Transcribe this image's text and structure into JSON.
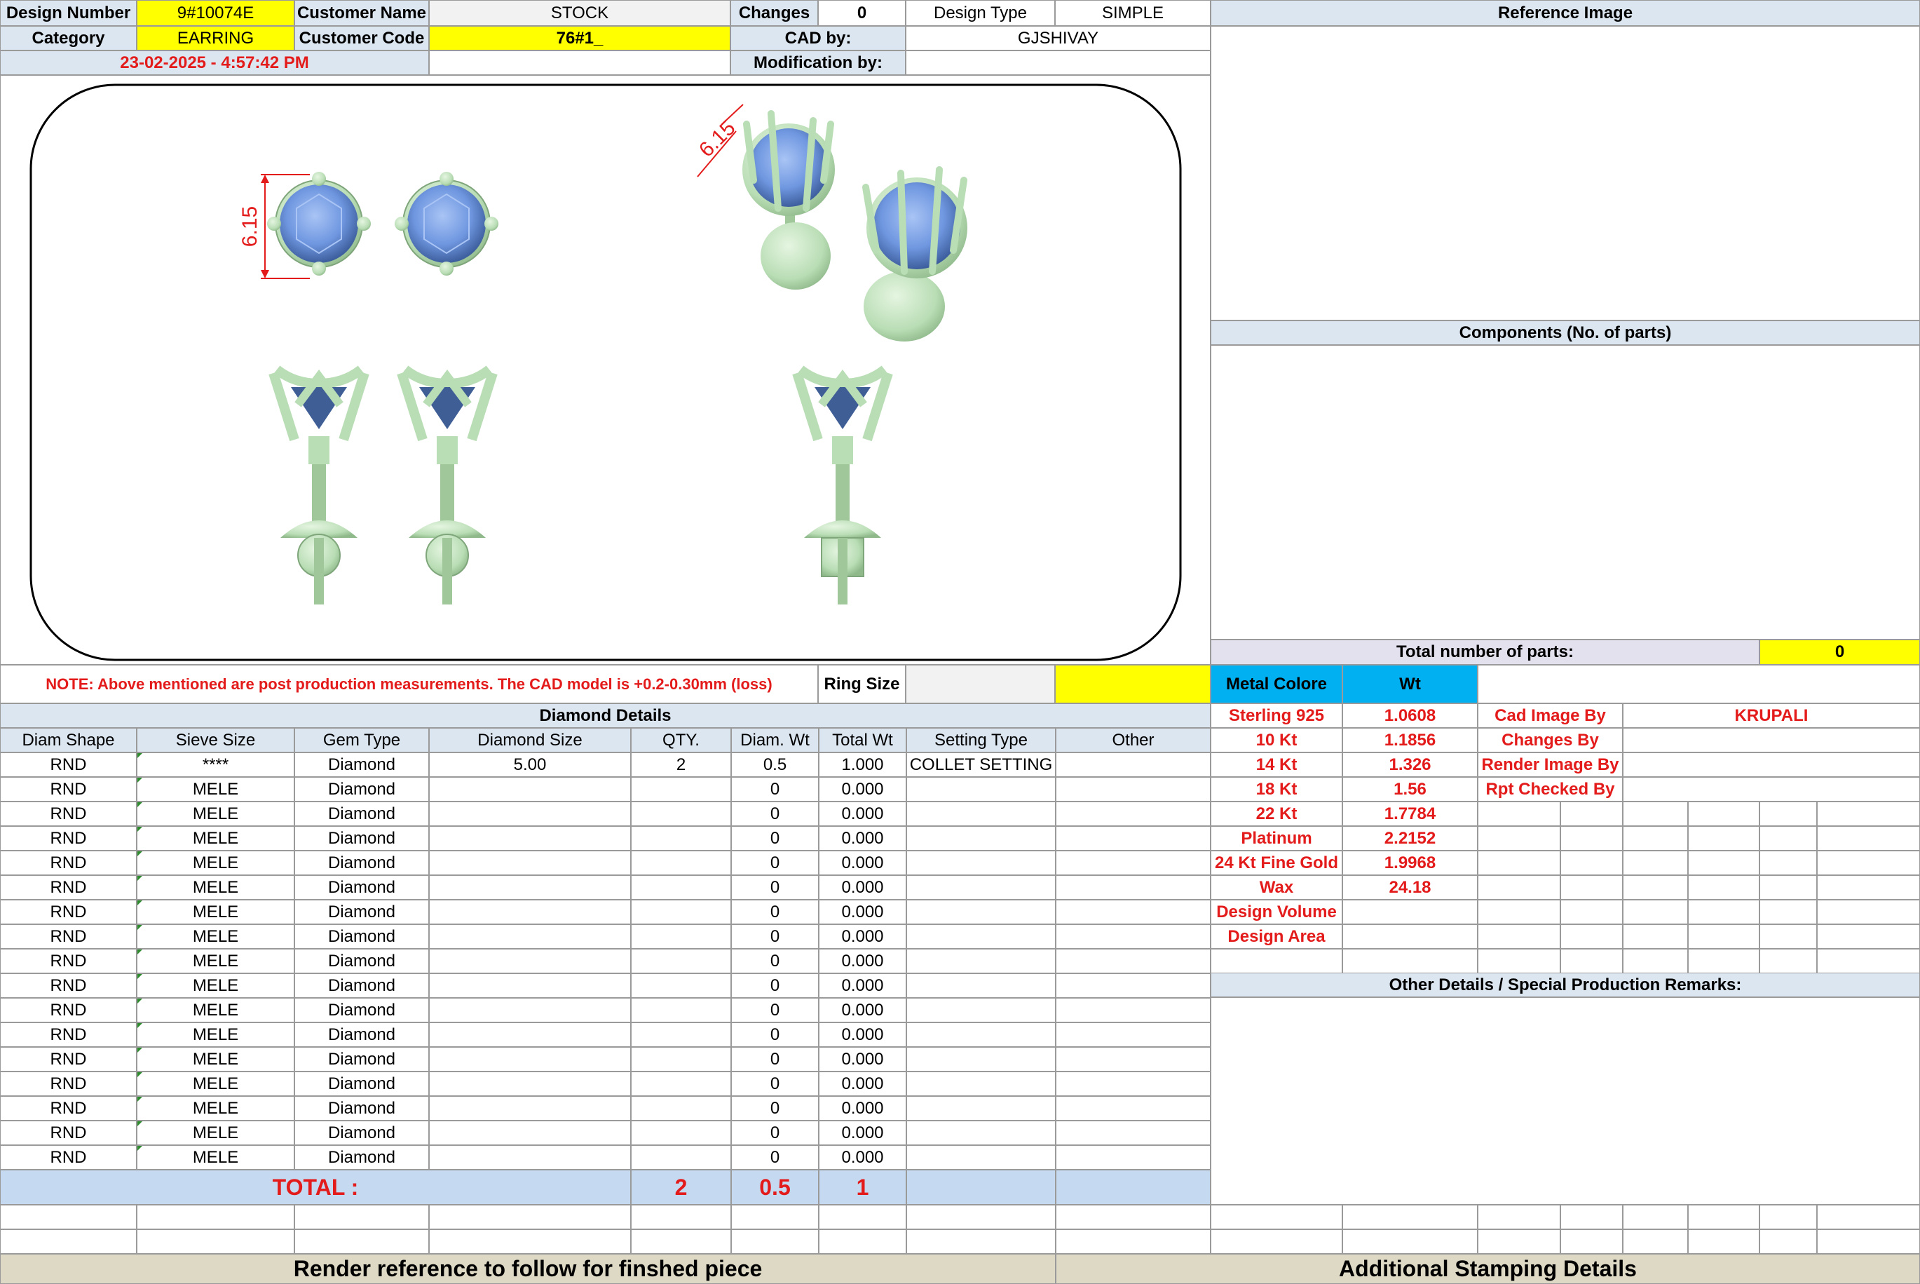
{
  "header": {
    "design_number_label": "Design Number",
    "design_number": "9#10074E",
    "customer_name_label": "Customer Name",
    "customer_name": "STOCK",
    "changes_label": "Changes",
    "changes": "0",
    "design_type_label": "Design Type",
    "design_type": "SIMPLE",
    "category_label": "Category",
    "category": "EARRING",
    "customer_code_label": "Customer Code",
    "customer_code": "76#1_",
    "cad_by_label": "CAD by:",
    "cad_by": "GJSHIVAY",
    "timestamp": "23-02-2025 - 4:57:42 PM",
    "modification_by_label": "Modification by:"
  },
  "render": {
    "dimension_label": "6.15"
  },
  "note": "NOTE: Above mentioned are post production measurements. The CAD model is +0.2-0.30mm (loss)",
  "ring_size_label": "Ring Size",
  "reference": {
    "title": "Reference Image",
    "components_title": "Components (No. of parts)",
    "total_parts_label": "Total number of parts:",
    "total_parts": "0"
  },
  "diamond": {
    "title": "Diamond Details",
    "columns": [
      "Diam Shape",
      "Sieve Size",
      "Gem Type",
      "Diamond Size",
      "QTY.",
      "Diam. Wt",
      "Total Wt",
      "Setting Type",
      "Other"
    ],
    "rows": [
      [
        "RND",
        "****",
        "Diamond",
        "5.00",
        "2",
        "0.5",
        "1.000",
        "COLLET SETTING",
        ""
      ],
      [
        "RND",
        "MELE",
        "Diamond",
        "",
        "",
        "0",
        "0.000",
        "",
        ""
      ],
      [
        "RND",
        "MELE",
        "Diamond",
        "",
        "",
        "0",
        "0.000",
        "",
        ""
      ],
      [
        "RND",
        "MELE",
        "Diamond",
        "",
        "",
        "0",
        "0.000",
        "",
        ""
      ],
      [
        "RND",
        "MELE",
        "Diamond",
        "",
        "",
        "0",
        "0.000",
        "",
        ""
      ],
      [
        "RND",
        "MELE",
        "Diamond",
        "",
        "",
        "0",
        "0.000",
        "",
        ""
      ],
      [
        "RND",
        "MELE",
        "Diamond",
        "",
        "",
        "0",
        "0.000",
        "",
        ""
      ],
      [
        "RND",
        "MELE",
        "Diamond",
        "",
        "",
        "0",
        "0.000",
        "",
        ""
      ],
      [
        "RND",
        "MELE",
        "Diamond",
        "",
        "",
        "0",
        "0.000",
        "",
        ""
      ],
      [
        "RND",
        "MELE",
        "Diamond",
        "",
        "",
        "0",
        "0.000",
        "",
        ""
      ],
      [
        "RND",
        "MELE",
        "Diamond",
        "",
        "",
        "0",
        "0.000",
        "",
        ""
      ],
      [
        "RND",
        "MELE",
        "Diamond",
        "",
        "",
        "0",
        "0.000",
        "",
        ""
      ],
      [
        "RND",
        "MELE",
        "Diamond",
        "",
        "",
        "0",
        "0.000",
        "",
        ""
      ],
      [
        "RND",
        "MELE",
        "Diamond",
        "",
        "",
        "0",
        "0.000",
        "",
        ""
      ],
      [
        "RND",
        "MELE",
        "Diamond",
        "",
        "",
        "0",
        "0.000",
        "",
        ""
      ],
      [
        "RND",
        "MELE",
        "Diamond",
        "",
        "",
        "0",
        "0.000",
        "",
        ""
      ],
      [
        "RND",
        "MELE",
        "Diamond",
        "",
        "",
        "0",
        "0.000",
        "",
        ""
      ]
    ],
    "total_label": "TOTAL :",
    "total_qty": "2",
    "total_diam_wt": "0.5",
    "total_wt": "1"
  },
  "metal": {
    "header_label": "Metal Colore",
    "wt_label": "Wt",
    "rows": [
      {
        "metal": "Sterling 925",
        "wt": "1.0608"
      },
      {
        "metal": "10 Kt",
        "wt": "1.1856"
      },
      {
        "metal": "14 Kt",
        "wt": "1.326"
      },
      {
        "metal": "18 Kt",
        "wt": "1.56"
      },
      {
        "metal": "22 Kt",
        "wt": "1.7784"
      },
      {
        "metal": "Platinum",
        "wt": "2.2152"
      },
      {
        "metal": "24 Kt Fine Gold",
        "wt": "1.9968"
      },
      {
        "metal": "Wax",
        "wt": "24.18"
      },
      {
        "metal": "Design Volume",
        "wt": ""
      },
      {
        "metal": "Design Area",
        "wt": ""
      }
    ]
  },
  "credits": [
    {
      "label": "Cad Image By",
      "value": "KRUPALI"
    },
    {
      "label": "Changes By",
      "value": ""
    },
    {
      "label": "Render Image By",
      "value": ""
    },
    {
      "label": "Rpt Checked By",
      "value": ""
    }
  ],
  "other_details_title": "Other Details / Special Production Remarks:",
  "footer": {
    "render_reference": "Render reference to follow for finshed piece",
    "stamping": "Additional Stamping Details"
  },
  "colors": {
    "header_blue": "#dce6f1",
    "highlight_yellow": "#ffff00",
    "metal_cyan": "#00b0f0",
    "total_blue": "#c5d9f1",
    "red_text": "#e31b1b",
    "metal_green": "#b9ddb5",
    "stone_blue": "#6f97e0"
  }
}
